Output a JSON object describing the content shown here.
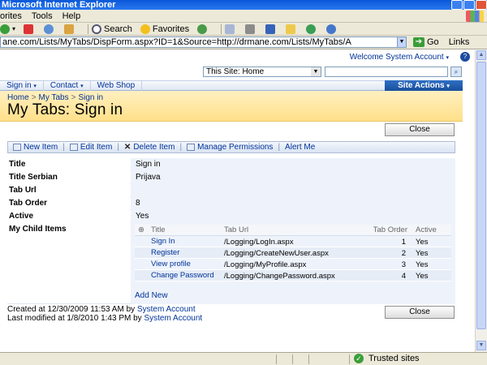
{
  "browser": {
    "title": "Microsoft Internet Explorer",
    "menu": [
      "orites",
      "Tools",
      "Help"
    ],
    "toolbar": {
      "search": "Search",
      "favorites": "Favorites"
    },
    "address": "ane.com/Lists/MyTabs/DispForm.aspx?ID=1&Source=http://drmane.com/Lists/MyTabs/A",
    "go_label": "Go",
    "links_label": "Links",
    "status_zone": "Trusted sites"
  },
  "site": {
    "welcome": "Welcome System Account",
    "search_scope": "This Site: Home",
    "search_value": "",
    "nav": [
      "Sign in",
      "Contact",
      "Web Shop"
    ],
    "site_actions": "Site Actions"
  },
  "page": {
    "breadcrumb": [
      "Home",
      "My Tabs",
      "Sign in"
    ],
    "title": "My Tabs: Sign in",
    "close_label": "Close"
  },
  "actions": [
    "New Item",
    "Edit Item",
    "Delete Item",
    "Manage Permissions",
    "Alert Me"
  ],
  "fields": [
    {
      "label": "Title",
      "value": "Sign in"
    },
    {
      "label": "Title Serbian",
      "value": "Prijava"
    },
    {
      "label": "Tab Url",
      "value": ""
    },
    {
      "label": "Tab Order",
      "value": "8"
    },
    {
      "label": "Active",
      "value": "Yes"
    }
  ],
  "child_items": {
    "label": "My Child Items",
    "columns": [
      "Title",
      "Tab Url",
      "Tab Order",
      "Active"
    ],
    "rows": [
      {
        "title": "Sign In",
        "url": "/Logging/LogIn.aspx",
        "order": "1",
        "active": "Yes"
      },
      {
        "title": "Register",
        "url": "/Logging/CreateNewUser.aspx",
        "order": "2",
        "active": "Yes"
      },
      {
        "title": "View profile",
        "url": "/Logging/MyProfile.aspx",
        "order": "3",
        "active": "Yes"
      },
      {
        "title": "Change Password",
        "url": "/Logging/ChangePassword.aspx",
        "order": "4",
        "active": "Yes"
      }
    ],
    "add_new": "Add New"
  },
  "footer": {
    "created_prefix": "Created at 12/30/2009 11:53 AM  by",
    "created_by": "System Account",
    "modified_prefix": "Last modified at 1/8/2010 1:43 PM  by",
    "modified_by": "System Account"
  }
}
